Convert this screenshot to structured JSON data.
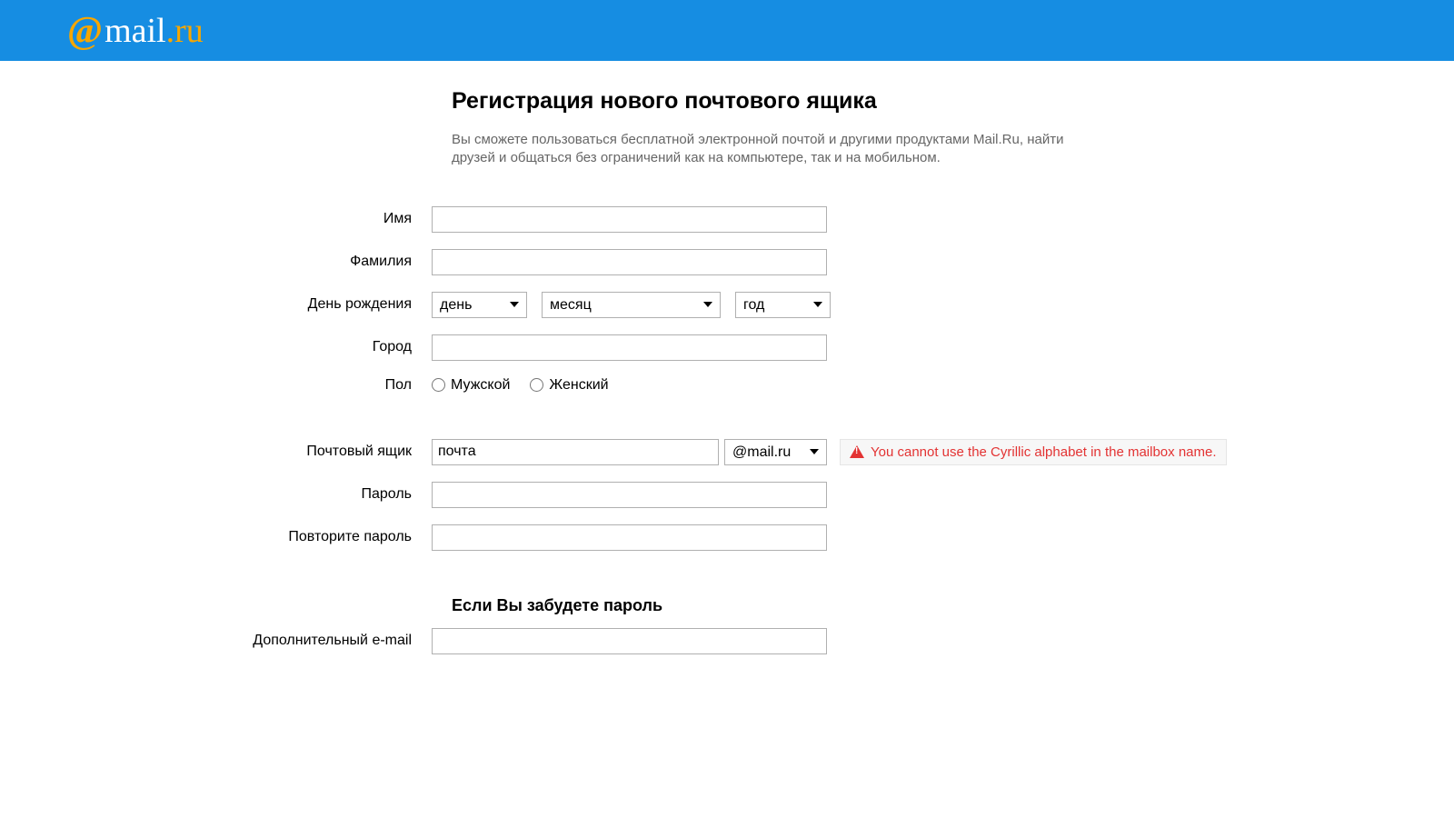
{
  "logo": {
    "at": "@",
    "mail": "mail",
    "dot_ru": ".ru"
  },
  "title": "Регистрация нового почтового ящика",
  "subtitle": "Вы сможете пользоваться бесплатной электронной почтой и другими продуктами Mail.Ru, найти друзей и общаться без ограничений как на компьютере, так и на мобильном.",
  "labels": {
    "first_name": "Имя",
    "last_name": "Фамилия",
    "birthday": "День рождения",
    "city": "Город",
    "gender": "Пол",
    "mailbox": "Почтовый ящик",
    "password": "Пароль",
    "password_repeat": "Повторите пароль",
    "extra_email": "Дополнительный e-mail"
  },
  "birthday": {
    "day": "день",
    "month": "месяц",
    "year": "год"
  },
  "gender": {
    "male": "Мужской",
    "female": "Женский"
  },
  "mailbox": {
    "value": "почта",
    "domain": "@mail.ru"
  },
  "error": {
    "message": "You cannot use the Cyrillic alphabet in the mailbox name."
  },
  "recovery_title": "Если Вы забудете пароль"
}
